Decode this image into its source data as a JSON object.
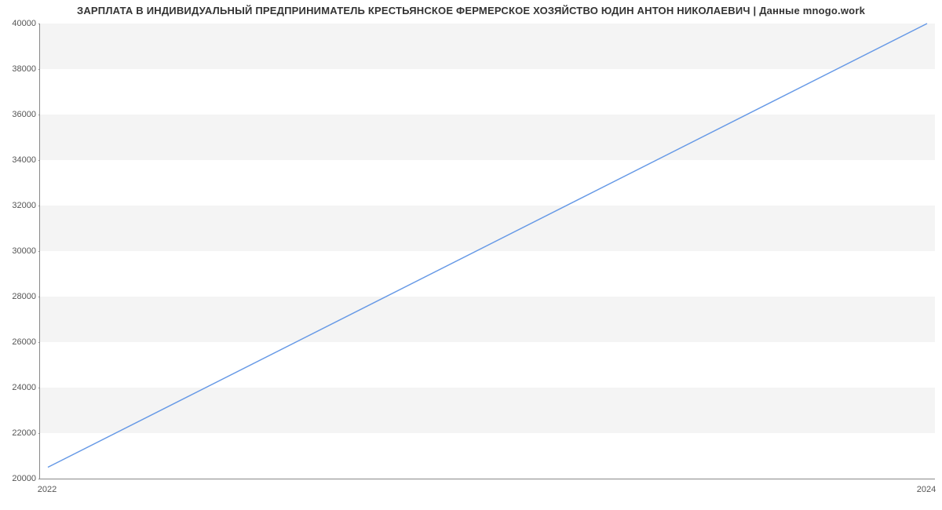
{
  "chart_data": {
    "type": "line",
    "title": "ЗАРПЛАТА В ИНДИВИДУАЛЬНЫЙ ПРЕДПРИНИМАТЕЛЬ КРЕСТЬЯНСКОЕ ФЕРМЕРСКОЕ ХОЗЯЙСТВО  ЮДИН АНТОН НИКОЛАЕВИЧ | Данные mnogo.work",
    "xlabel": "",
    "ylabel": "",
    "x_ticks": [
      "2022",
      "2024"
    ],
    "y_ticks": [
      20000,
      22000,
      24000,
      26000,
      28000,
      30000,
      32000,
      34000,
      36000,
      38000,
      40000
    ],
    "xlim": [
      2022,
      2024
    ],
    "ylim": [
      20000,
      40000
    ],
    "series": [
      {
        "name": "salary",
        "color": "#6699e6",
        "x": [
          2022,
          2024
        ],
        "y": [
          20500,
          40000
        ]
      }
    ]
  }
}
